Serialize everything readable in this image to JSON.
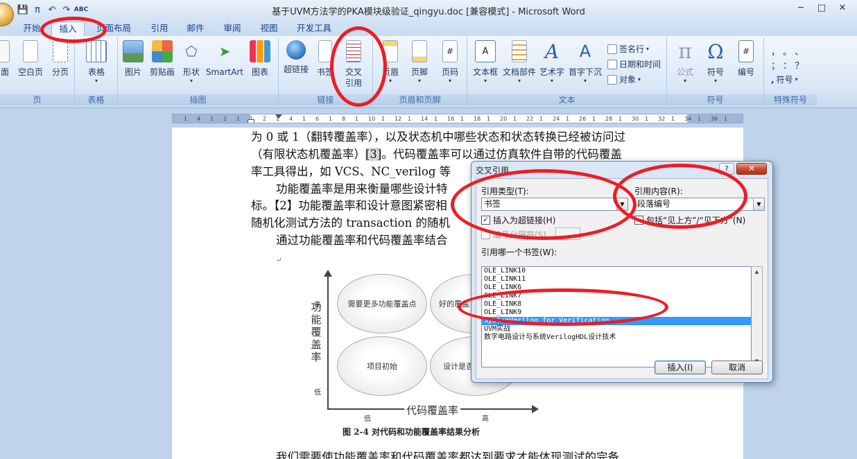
{
  "window": {
    "title": "基于UVM方法学的PKA模块级验证_qingyu.doc [兼容模式] - Microsoft Word",
    "controls": {
      "minimize": "─",
      "maximize": "□",
      "close": "✕"
    }
  },
  "qat": {
    "save": "💾",
    "pi": "π",
    "undo": "↶",
    "redo": "↷",
    "abc": "ABC"
  },
  "tabs": [
    {
      "label": "开始"
    },
    {
      "label": "插入"
    },
    {
      "label": "页面布局"
    },
    {
      "label": "引用"
    },
    {
      "label": "邮件"
    },
    {
      "label": "审阅"
    },
    {
      "label": "视图"
    },
    {
      "label": "开发工具"
    }
  ],
  "ribbon": {
    "pages": {
      "label": "页",
      "cover": "面",
      "blank": "空白页",
      "break": "分页"
    },
    "tables": {
      "label": "表格",
      "table": "表格"
    },
    "illustrations": {
      "label": "插图",
      "picture": "图片",
      "clipart": "剪贴画",
      "shapes": "形状",
      "smartart": "SmartArt",
      "chart": "图表"
    },
    "links": {
      "label": "链接",
      "hyperlink": "超链接",
      "bookmark": "书签",
      "crossref_1": "交叉",
      "crossref_2": "引用"
    },
    "header_footer": {
      "label": "页眉和页脚",
      "header": "页眉",
      "footer": "页脚",
      "page_number": "页码"
    },
    "text": {
      "label": "文本",
      "textbox": "文本框",
      "quickparts": "文档部件",
      "wordart": "艺术字",
      "dropcap": "首字下沉",
      "signature": "签名行",
      "datetime": "日期和时间",
      "object": "对象"
    },
    "symbols": {
      "label": "符号",
      "equation": "公式",
      "symbol": "符号",
      "number": "编号"
    },
    "special": {
      "label": "特殊符号",
      "symbol_btn": "符号",
      "row1": "，  。  、",
      "row2": "；  ：  ？"
    }
  },
  "ruler": {
    "numbers": [
      "1",
      "4",
      "1",
      "2",
      "1",
      "1",
      "2",
      "1",
      "4",
      "1",
      "6",
      "1",
      "8",
      "1",
      "10",
      "1",
      "12",
      "1",
      "14",
      "1",
      "16",
      "1",
      "18",
      "1",
      "20",
      "1",
      "22",
      "1",
      "24",
      "1",
      "26",
      "1",
      "28",
      "1",
      "30",
      "1",
      "32",
      "1",
      "34",
      "1",
      "36",
      "1"
    ]
  },
  "document": {
    "p1": "为 0 或 1（翻转覆盖率），以及状态机中哪些状态和状态转换已经被访问过",
    "p2a": "（有限状态机覆盖率）",
    "p2cite": "[3]",
    "p2b": "。代码覆盖率可以通过仿真软件自带的代码覆盖",
    "p3": "率工具得出，如 VCS、NC_verilog 等",
    "p4": "功能覆盖率是用来衡量哪些设计特",
    "p5": "标。【2】功能覆盖率和设计意图紧密相",
    "p6": "随机化测试方法的 transaction 的随机",
    "p7": "通过功能覆盖率和代码覆盖率结合",
    "para_mark": "↵",
    "bottom": "我们需要使功能覆盖率和代码覆盖率都达到要求才能体现测试的完备"
  },
  "figure": {
    "q_top_left": "需要更多功能覆盖点",
    "q_top_right": "好的覆盖",
    "q_bottom_left": "项目初始",
    "q_bottom_right": "设计是否",
    "y_axis": "功能覆盖率",
    "x_axis": "代码覆盖率",
    "y_high": "高",
    "y_low": "低",
    "x_low": "低",
    "x_high": "高",
    "caption": "图 2-4  对代码和功能覆盖率结果分析"
  },
  "dialog": {
    "title": "交叉引用",
    "help": "?",
    "close": "✕",
    "ref_type_label": "引用类型(T):",
    "ref_type_value": "书签",
    "ref_content_label": "引用内容(R):",
    "ref_content_value": "段落编号",
    "insert_hyperlink": "插入为超链接(H)",
    "include_above_below": "包括“见上方”/“见下方”(N)",
    "separator_label": "编号分隔符(S)",
    "which_label": "引用哪一个书签(W):",
    "bookmarks": [
      "OLE_LINK10",
      "OLE_LINK11",
      "OLE_LINK6",
      "OLE_LINK7",
      "OLE_LINK8",
      "OLE_LINK9",
      "SystemVerilog_for_Verification",
      "UVM实战",
      "数字电路设计与系统VerilogHDL设计技术"
    ],
    "selected_bookmark": "SystemVerilog_for_Verification",
    "insert_button": "插入(I)",
    "cancel_button": "取消"
  }
}
